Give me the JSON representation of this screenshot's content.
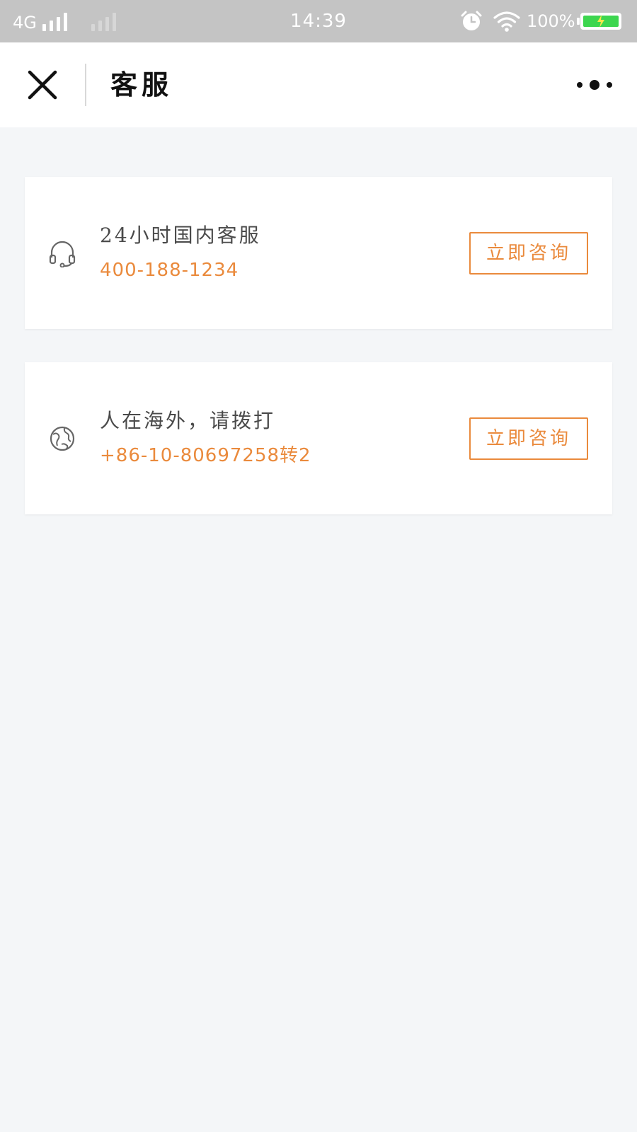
{
  "status_bar": {
    "network": "4G",
    "time": "14:39",
    "battery_percent": "100%",
    "icons": [
      "signal-bars-icon",
      "alarm-icon",
      "wifi-icon",
      "battery-charging-icon"
    ],
    "battery_color": "#3dd64f"
  },
  "nav": {
    "title": "客服",
    "close_icon": "close-icon",
    "more_icon": "more-options-icon"
  },
  "cards": [
    {
      "icon": "headset-icon",
      "title": "24小时国内客服",
      "phone": "400-188-1234",
      "button_label": "立即咨询"
    },
    {
      "icon": "globe-icon",
      "title": "人在海外，请拨打",
      "phone": "+86-10-80697258转2",
      "button_label": "立即咨询"
    }
  ],
  "colors": {
    "accent": "#ea8a3c",
    "page_background": "#f4f6f8",
    "status_bar_background": "#c4c4c4"
  }
}
